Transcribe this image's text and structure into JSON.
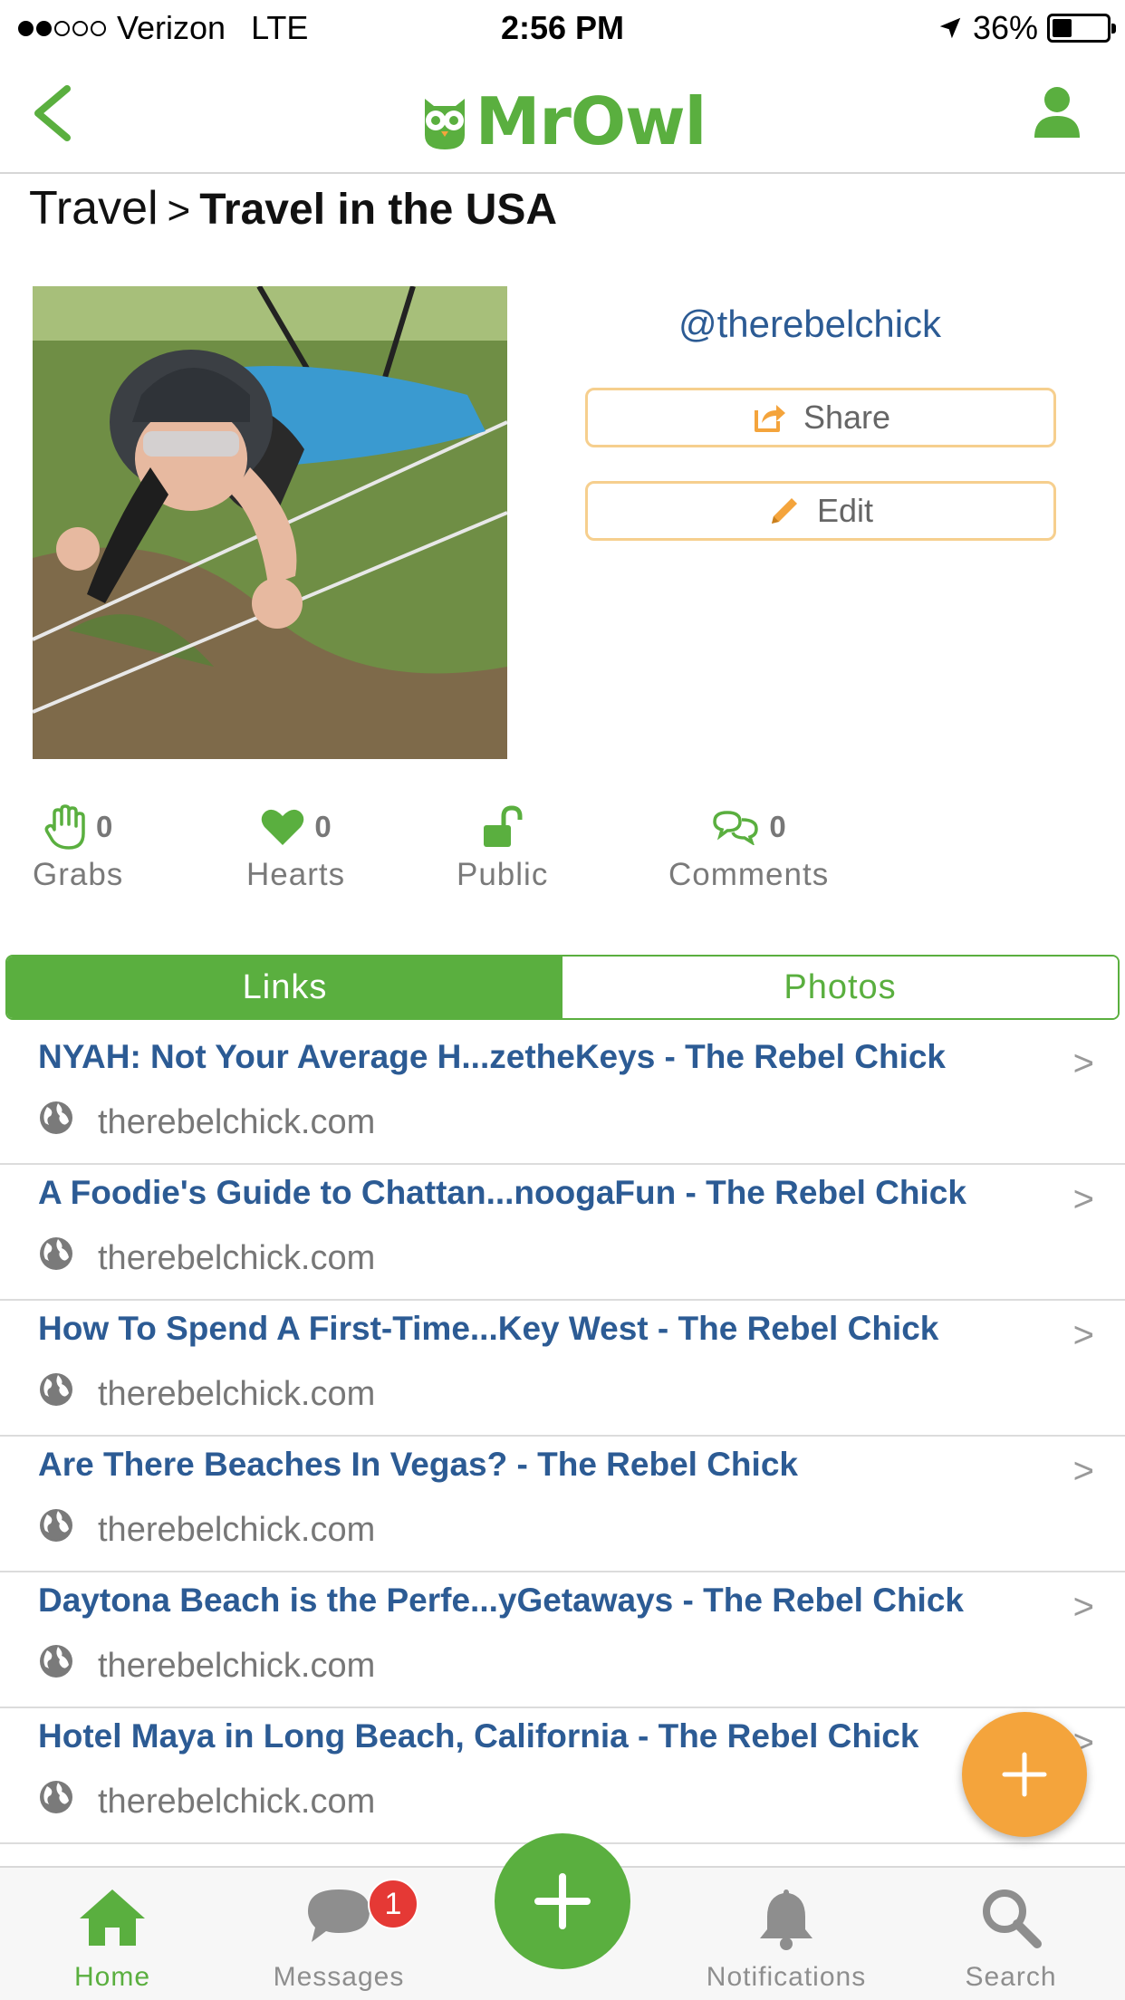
{
  "status_bar": {
    "carrier": "Verizon",
    "network": "LTE",
    "time": "2:56 PM",
    "battery": "36%",
    "battery_level": 0.36,
    "signal_bars": 2,
    "signal_total": 5
  },
  "nav": {
    "logo": "MrOwl",
    "back_icon": "chevron-left-icon",
    "user_icon": "user-icon"
  },
  "breadcrumb": {
    "parent": "Travel",
    "separator": ">",
    "current": "Travel in the USA"
  },
  "profile": {
    "username": "@therebelchick",
    "share_label": "Share",
    "edit_label": "Edit"
  },
  "stats": {
    "grabs": {
      "count": "0",
      "label": "Grabs"
    },
    "hearts": {
      "count": "0",
      "label": "Hearts"
    },
    "visibility": {
      "label": "Public"
    },
    "comments": {
      "count": "0",
      "label": "Comments"
    }
  },
  "tabs": [
    {
      "label": "Links"
    },
    {
      "label": "Photos"
    }
  ],
  "links": [
    {
      "title": "NYAH: Not Your Average H...zetheKeys - The Rebel Chick",
      "domain": "therebelchick.com"
    },
    {
      "title": "A Foodie's Guide to Chattan...noogaFun - The Rebel Chick",
      "domain": "therebelchick.com"
    },
    {
      "title": "How To Spend A First-Time...Key West - The Rebel Chick",
      "domain": "therebelchick.com"
    },
    {
      "title": "Are There Beaches In Vegas? - The Rebel Chick",
      "domain": "therebelchick.com"
    },
    {
      "title": "Daytona Beach is the Perfe...yGetaways - The Rebel Chick",
      "domain": "therebelchick.com"
    },
    {
      "title": "Hotel Maya in Long Beach, California - The Rebel Chick",
      "domain": "therebelchick.com"
    }
  ],
  "chevron": ">",
  "tabbar": {
    "home": "Home",
    "messages": "Messages",
    "messages_badge": "1",
    "notifications": "Notifications",
    "search": "Search"
  },
  "colors": {
    "brand_green": "#5aaf3f",
    "link_blue": "#2c5b94",
    "accent_orange": "#f4a43c",
    "badge_red": "#e53935"
  }
}
